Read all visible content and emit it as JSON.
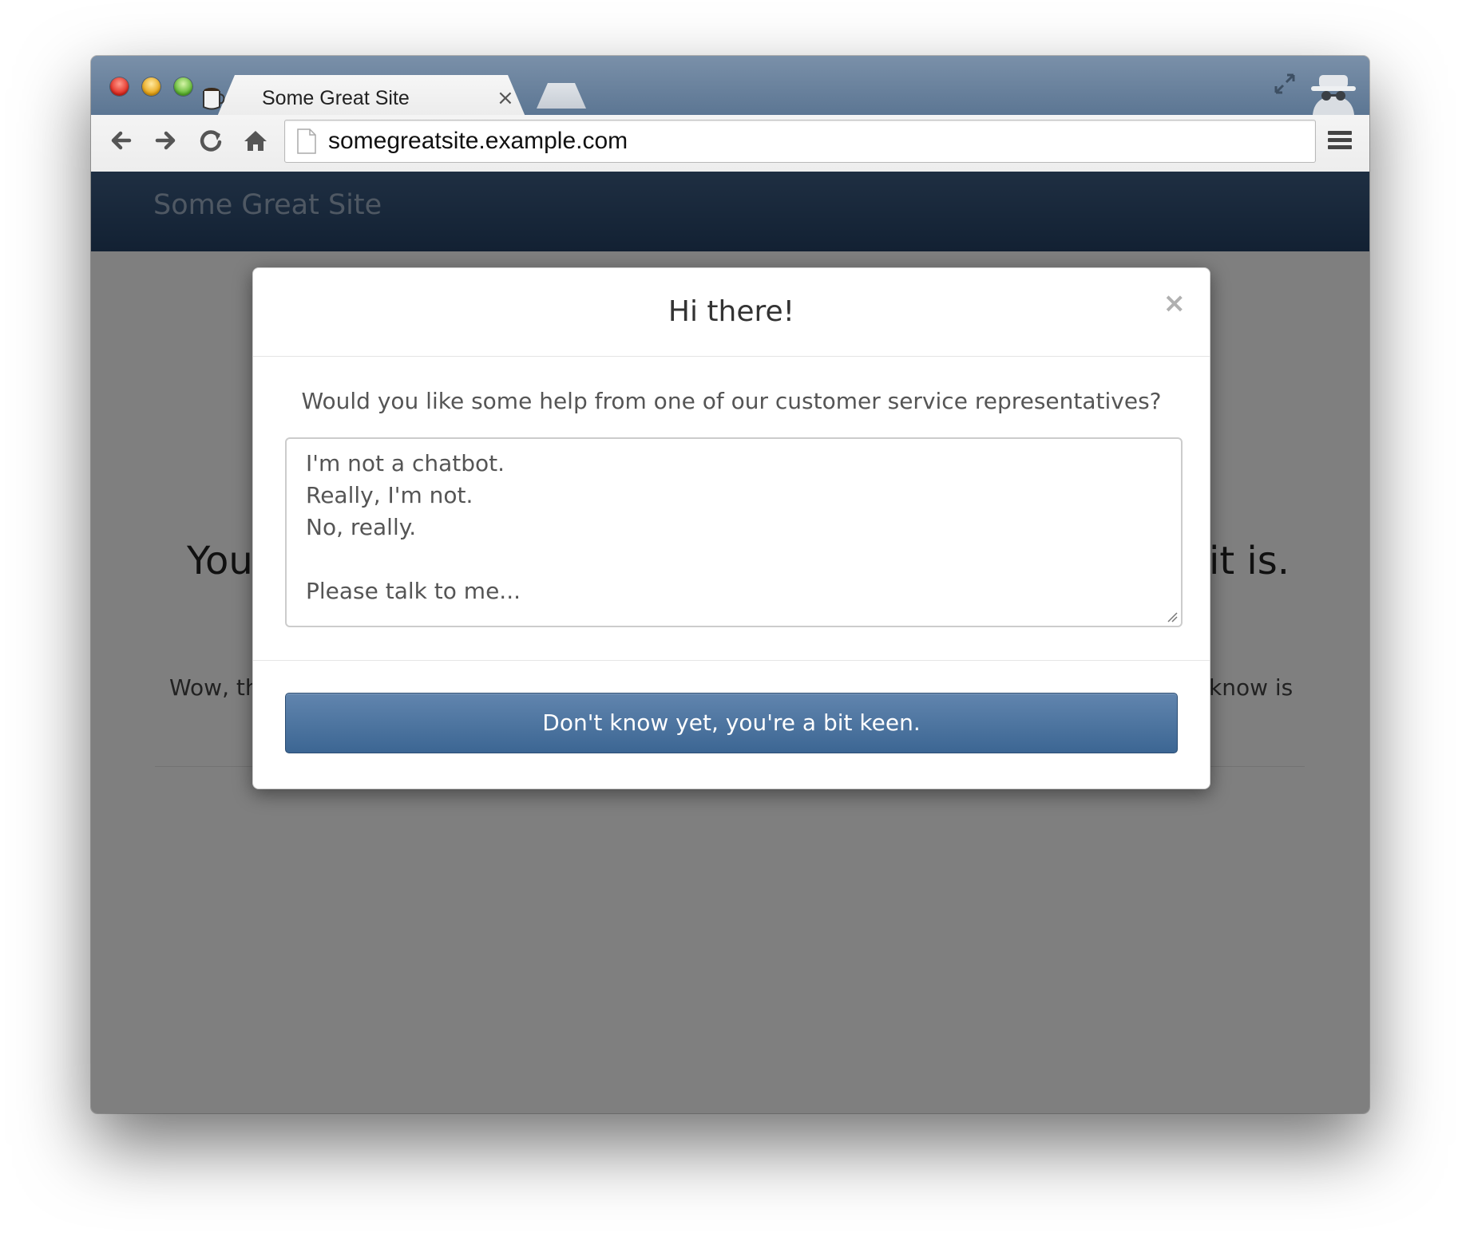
{
  "browser": {
    "tab_title": "Some Great Site",
    "tab_close": "×",
    "url": "somegreatsite.example.com",
    "icons": [
      "coffee-cup-favicon",
      "fullscreen-icon",
      "incognito-icon",
      "back-arrow-icon",
      "forward-arrow-icon",
      "reload-icon",
      "home-icon",
      "page-icon",
      "hamburger-menu-icon"
    ]
  },
  "site": {
    "brand": "Some Great Site",
    "hero_left_visible": "You",
    "hero_right_visible": "it is.",
    "lead_left_visible": "Wow, th",
    "lead_right_visible": "know is"
  },
  "modal": {
    "title": "Hi there!",
    "close": "×",
    "question": "Would you like some help from one of our customer service representatives?",
    "textarea_lines": [
      "I'm not a chatbot.",
      "Really, I'm not.",
      "No, really.",
      "",
      "Please talk to me..."
    ],
    "button_label": "Don't know yet, you're a bit keen."
  },
  "colors": {
    "tabstrip": "#5c7693",
    "navbar": "#254266",
    "button": "#3c6693",
    "backdrop": "rgba(0,0,0,0.5)"
  }
}
